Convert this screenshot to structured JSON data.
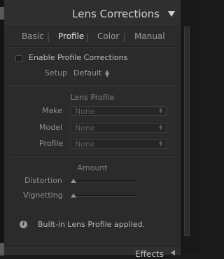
{
  "panel": {
    "title": "Lens Corrections",
    "next_panel_title": "Effects"
  },
  "tabs": [
    {
      "label": "Basic",
      "active": false
    },
    {
      "label": "Profile",
      "active": true
    },
    {
      "label": "Color",
      "active": false
    },
    {
      "label": "Manual",
      "active": false
    }
  ],
  "enable_profile": {
    "label": "Enable Profile Corrections",
    "checked": false
  },
  "setup": {
    "label": "Setup",
    "value": "Default"
  },
  "lens_profile": {
    "title": "Lens Profile",
    "make": {
      "label": "Make",
      "value": "None"
    },
    "model": {
      "label": "Model",
      "value": "None"
    },
    "profile": {
      "label": "Profile",
      "value": "None"
    }
  },
  "amount": {
    "title": "Amount",
    "distortion": {
      "label": "Distortion",
      "level": 0
    },
    "vignetting": {
      "label": "Vignetting",
      "level": 0
    }
  },
  "info": {
    "icon_glyph": "i",
    "message": "Built-in Lens Profile applied."
  }
}
